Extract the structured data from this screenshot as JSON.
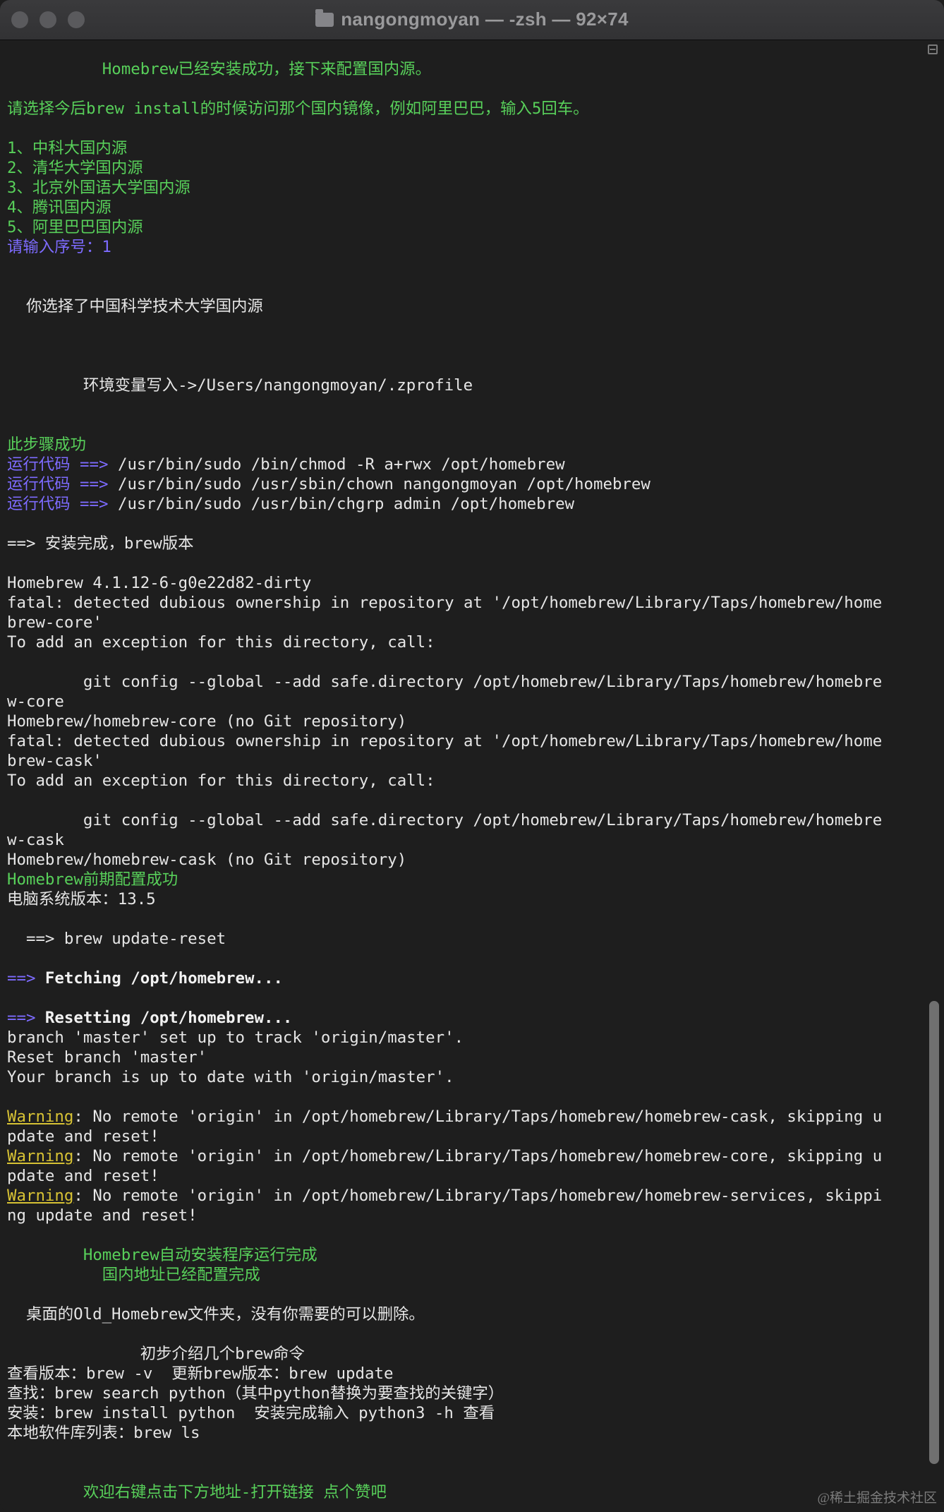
{
  "window": {
    "title": "nangongmoyan — -zsh — 92×74",
    "title_icon": "folder-icon",
    "traffic_lights": [
      "close",
      "minimize",
      "zoom"
    ]
  },
  "colors": {
    "background": "#1e1e1e",
    "green": "#58d05a",
    "purple": "#7d6bff",
    "white": "#e6e6e6",
    "warning": "#d7c234"
  },
  "terminal_lines": [
    [
      {
        "t": "          Homebrew已经安装成功，接下来配置国内源。",
        "c": "g"
      }
    ],
    [],
    [
      {
        "t": "请选择今后brew install的时候访问那个国内镜像，例如阿里巴巴，输入5回车。",
        "c": "g"
      }
    ],
    [],
    [
      {
        "t": "1、中科大国内源",
        "c": "g"
      }
    ],
    [
      {
        "t": "2、清华大学国内源",
        "c": "g"
      }
    ],
    [
      {
        "t": "3、北京外国语大学国内源",
        "c": "g"
      }
    ],
    [
      {
        "t": "4、腾讯国内源",
        "c": "g"
      }
    ],
    [
      {
        "t": "5、阿里巴巴国内源",
        "c": "g"
      }
    ],
    [
      {
        "t": "请输入序号：1",
        "c": "p"
      }
    ],
    [],
    [],
    [
      {
        "t": "  你选择了中国科学技术大学国内源",
        "c": "w"
      }
    ],
    [],
    [],
    [],
    [
      {
        "t": "        环境变量写入->/Users/nangongmoyan/.zprofile",
        "c": "w"
      }
    ],
    [],
    [],
    [
      {
        "t": "此步骤成功",
        "c": "g"
      }
    ],
    [
      {
        "t": "运行代码 ==> ",
        "c": "p"
      },
      {
        "t": "/usr/bin/sudo /bin/chmod -R a+rwx /opt/homebrew",
        "c": "w"
      }
    ],
    [
      {
        "t": "运行代码 ==> ",
        "c": "p"
      },
      {
        "t": "/usr/bin/sudo /usr/sbin/chown nangongmoyan /opt/homebrew",
        "c": "w"
      }
    ],
    [
      {
        "t": "运行代码 ==> ",
        "c": "p"
      },
      {
        "t": "/usr/bin/sudo /usr/bin/chgrp admin /opt/homebrew",
        "c": "w"
      }
    ],
    [],
    [
      {
        "t": "==> 安装完成，brew版本",
        "c": "w"
      }
    ],
    [],
    [
      {
        "t": "Homebrew 4.1.12-6-g0e22d82-dirty",
        "c": "w"
      }
    ],
    [
      {
        "t": "fatal: detected dubious ownership in repository at '/opt/homebrew/Library/Taps/homebrew/home",
        "c": "w"
      }
    ],
    [
      {
        "t": "brew-core'",
        "c": "w"
      }
    ],
    [
      {
        "t": "To add an exception for this directory, call:",
        "c": "w"
      }
    ],
    [],
    [
      {
        "t": "        git config --global --add safe.directory /opt/homebrew/Library/Taps/homebrew/homebre",
        "c": "w"
      }
    ],
    [
      {
        "t": "w-core",
        "c": "w"
      }
    ],
    [
      {
        "t": "Homebrew/homebrew-core (no Git repository)",
        "c": "w"
      }
    ],
    [
      {
        "t": "fatal: detected dubious ownership in repository at '/opt/homebrew/Library/Taps/homebrew/home",
        "c": "w"
      }
    ],
    [
      {
        "t": "brew-cask'",
        "c": "w"
      }
    ],
    [
      {
        "t": "To add an exception for this directory, call:",
        "c": "w"
      }
    ],
    [],
    [
      {
        "t": "        git config --global --add safe.directory /opt/homebrew/Library/Taps/homebrew/homebre",
        "c": "w"
      }
    ],
    [
      {
        "t": "w-cask",
        "c": "w"
      }
    ],
    [
      {
        "t": "Homebrew/homebrew-cask (no Git repository)",
        "c": "w"
      }
    ],
    [
      {
        "t": "Homebrew前期配置成功",
        "c": "g"
      }
    ],
    [
      {
        "t": "电脑系统版本：13.5",
        "c": "w"
      }
    ],
    [],
    [
      {
        "t": "  ==> brew update-reset",
        "c": "w"
      }
    ],
    [],
    [
      {
        "t": "==> ",
        "c": "p"
      },
      {
        "t": "Fetching /opt/homebrew...",
        "c": "b"
      }
    ],
    [],
    [
      {
        "t": "==> ",
        "c": "p"
      },
      {
        "t": "Resetting /opt/homebrew...",
        "c": "b"
      }
    ],
    [
      {
        "t": "branch 'master' set up to track 'origin/master'.",
        "c": "w"
      }
    ],
    [
      {
        "t": "Reset branch 'master'",
        "c": "w"
      }
    ],
    [
      {
        "t": "Your branch is up to date with 'origin/master'.",
        "c": "w"
      }
    ],
    [],
    [
      {
        "t": "Warning",
        "c": "warn"
      },
      {
        "t": ": No remote 'origin' in /opt/homebrew/Library/Taps/homebrew/homebrew-cask, skipping u",
        "c": "w"
      }
    ],
    [
      {
        "t": "pdate and reset!",
        "c": "w"
      }
    ],
    [
      {
        "t": "Warning",
        "c": "warn"
      },
      {
        "t": ": No remote 'origin' in /opt/homebrew/Library/Taps/homebrew/homebrew-core, skipping u",
        "c": "w"
      }
    ],
    [
      {
        "t": "pdate and reset!",
        "c": "w"
      }
    ],
    [
      {
        "t": "Warning",
        "c": "warn"
      },
      {
        "t": ": No remote 'origin' in /opt/homebrew/Library/Taps/homebrew/homebrew-services, skippi",
        "c": "w"
      }
    ],
    [
      {
        "t": "ng update and reset!",
        "c": "w"
      }
    ],
    [],
    [
      {
        "t": "        Homebrew自动安装程序运行完成",
        "c": "g"
      }
    ],
    [
      {
        "t": "          国内地址已经配置完成",
        "c": "g"
      }
    ],
    [],
    [
      {
        "t": "  桌面的Old_Homebrew文件夹，没有你需要的可以删除。",
        "c": "w"
      }
    ],
    [],
    [
      {
        "t": "              初步介绍几个brew命令",
        "c": "w"
      }
    ],
    [
      {
        "t": "查看版本：brew -v  更新brew版本：brew update",
        "c": "w"
      }
    ],
    [
      {
        "t": "查找：brew search python（其中python替换为要查找的关键字）",
        "c": "w"
      }
    ],
    [
      {
        "t": "安装：brew install python  安装完成输入 python3 -h 查看",
        "c": "w"
      }
    ],
    [
      {
        "t": "本地软件库列表：brew ls",
        "c": "w"
      }
    ],
    [],
    [],
    [
      {
        "t": "        欢迎右键点击下方地址-打开链接 点个赞吧",
        "c": "g"
      }
    ]
  ],
  "watermark": "@稀土掘金技术社区"
}
